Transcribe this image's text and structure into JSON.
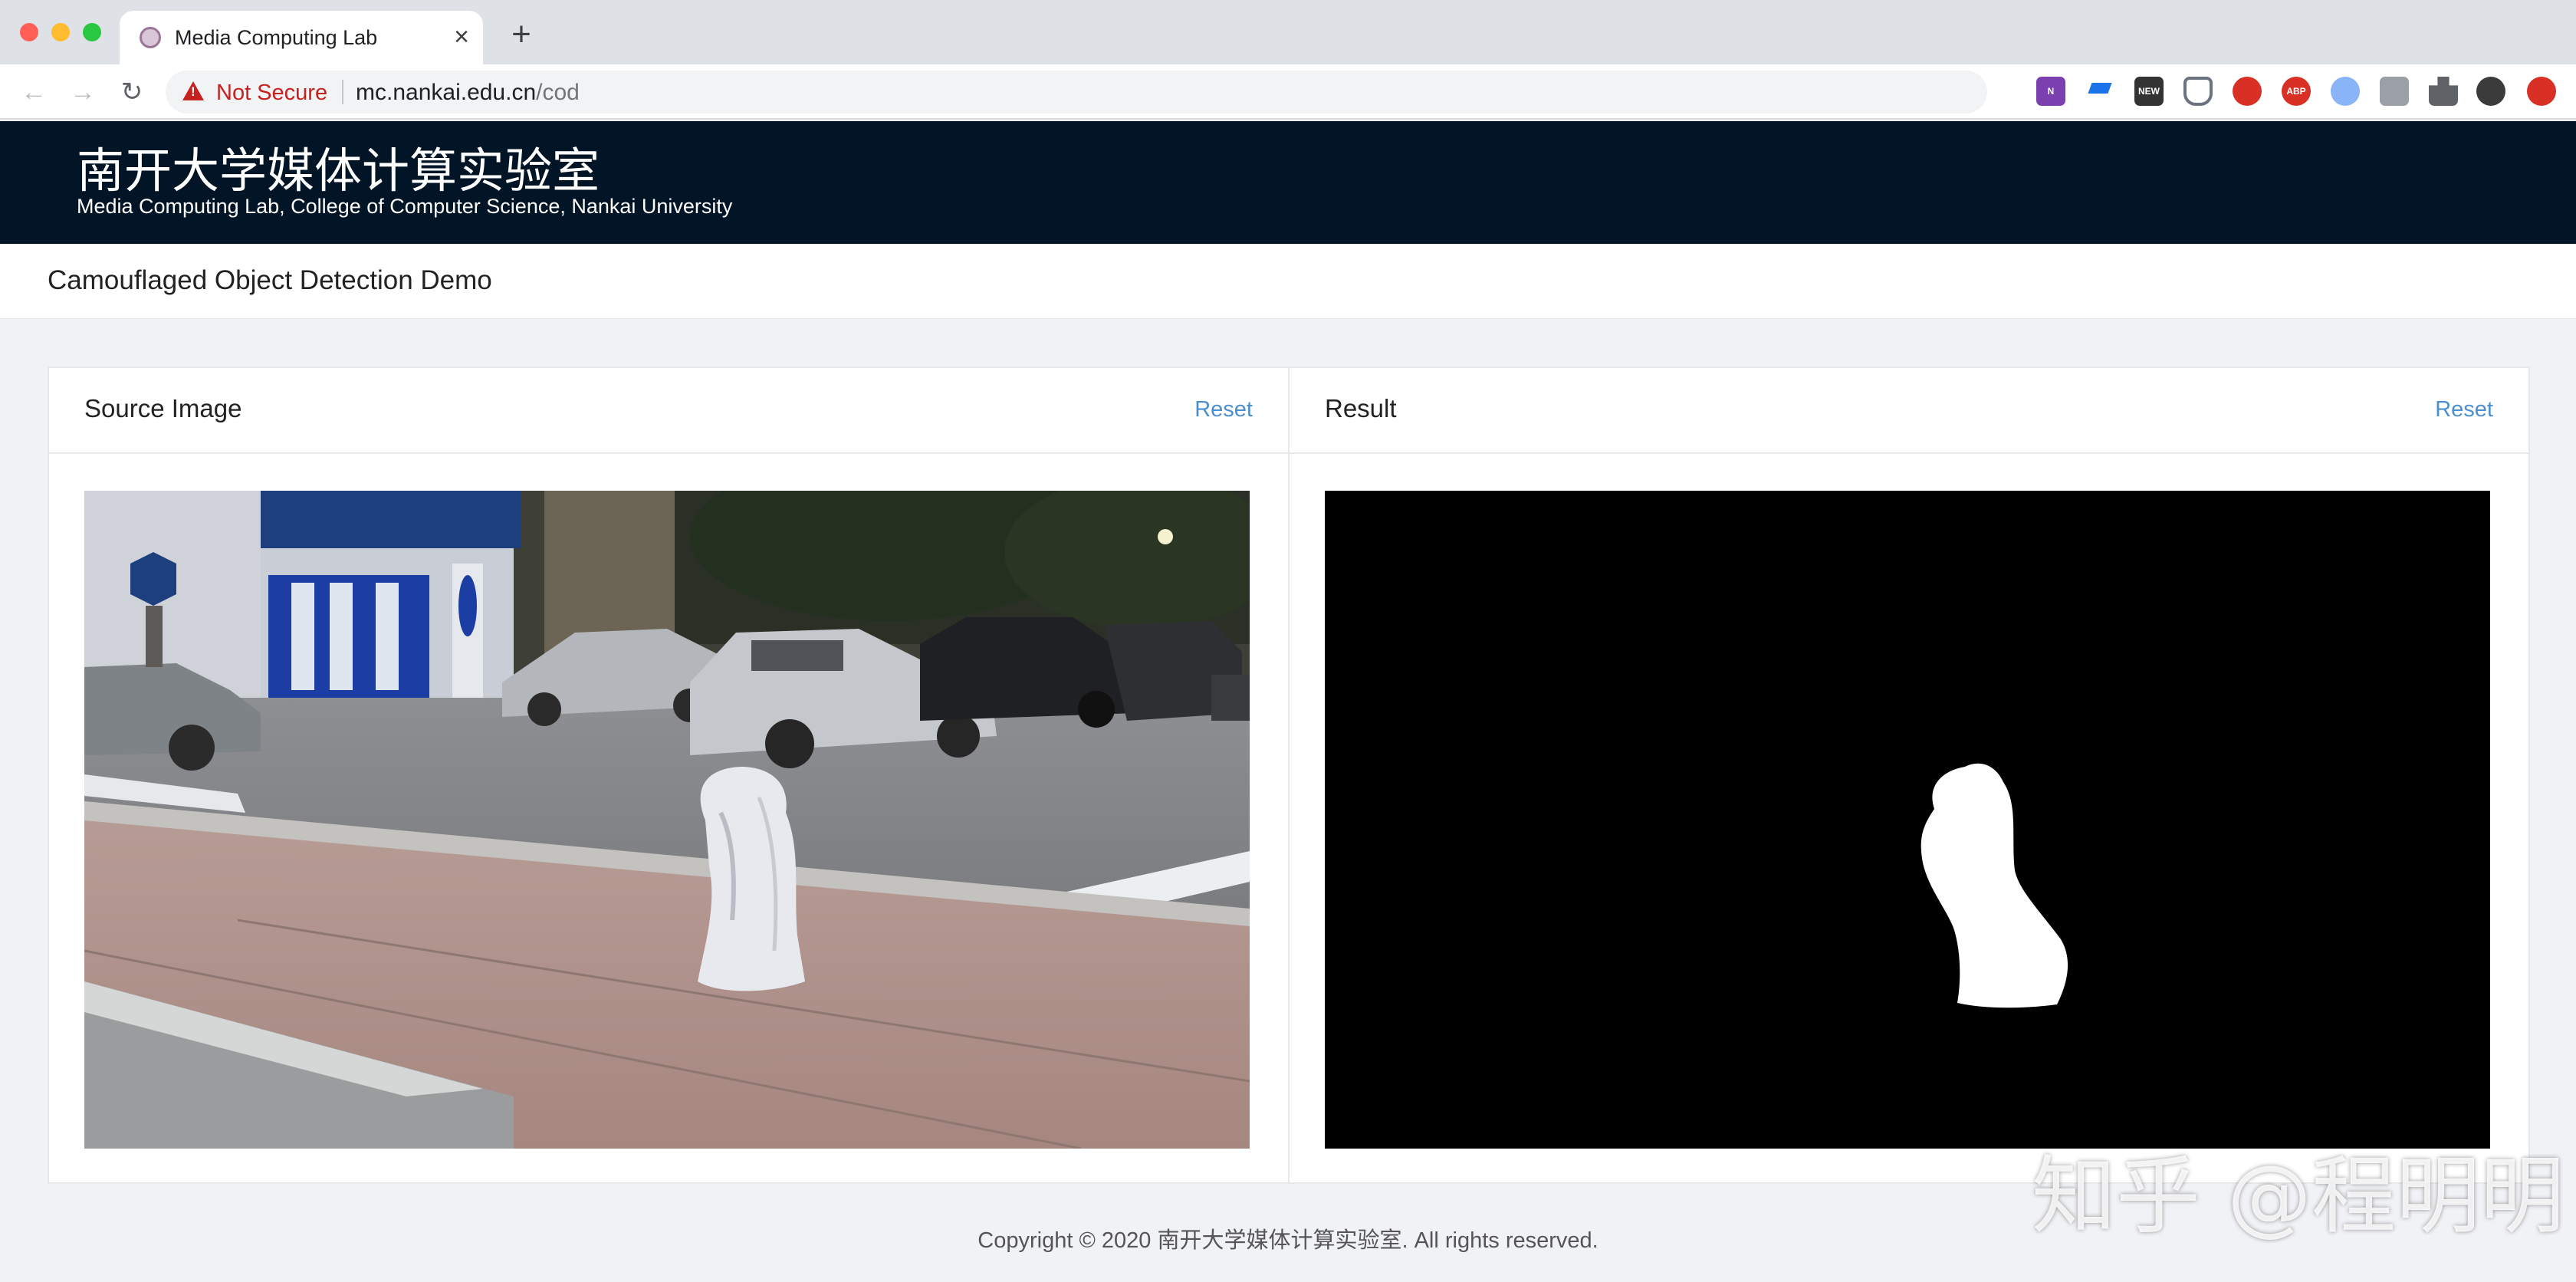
{
  "browser": {
    "tab": {
      "title": "Media Computing Lab",
      "close": "×"
    },
    "new_tab": "+",
    "nav": {
      "back": "←",
      "forward": "→",
      "reload": "↻"
    },
    "security_label": "Not Secure",
    "url_host": "mc.nankai.edu.cn",
    "url_path": "/cod",
    "bookmark_icon": "☆",
    "extensions": [
      {
        "name": "onenote-icon",
        "label": "N"
      },
      {
        "name": "graduation-cap-icon",
        "label": ""
      },
      {
        "name": "news-icon",
        "label": "NEW"
      },
      {
        "name": "shield-icon",
        "label": ""
      },
      {
        "name": "stop-hand-icon",
        "label": ""
      },
      {
        "name": "adblock-icon",
        "label": "ABP"
      },
      {
        "name": "bird-icon",
        "label": ""
      },
      {
        "name": "box-icon",
        "label": ""
      },
      {
        "name": "puzzle-icon",
        "label": ""
      },
      {
        "name": "profile-avatar-icon",
        "label": ""
      },
      {
        "name": "update-icon",
        "label": ""
      }
    ]
  },
  "site": {
    "title_cn": "南开大学媒体计算实验室",
    "title_en": "Media Computing Lab, College of Computer Science, Nankai University",
    "page_title": "Camouflaged Object Detection Demo"
  },
  "panels": {
    "source": {
      "title": "Source Image",
      "reset": "Reset"
    },
    "result": {
      "title": "Result",
      "reset": "Reset"
    }
  },
  "footer": {
    "text": "Copyright © 2020 南开大学媒体计算实验室. All rights reserved."
  },
  "watermark": "知乎 @程明明",
  "colors": {
    "header_bg": "#021526",
    "link": "#4a8fd0",
    "warning": "#c5221f",
    "page_bg": "#f0f2f5"
  }
}
